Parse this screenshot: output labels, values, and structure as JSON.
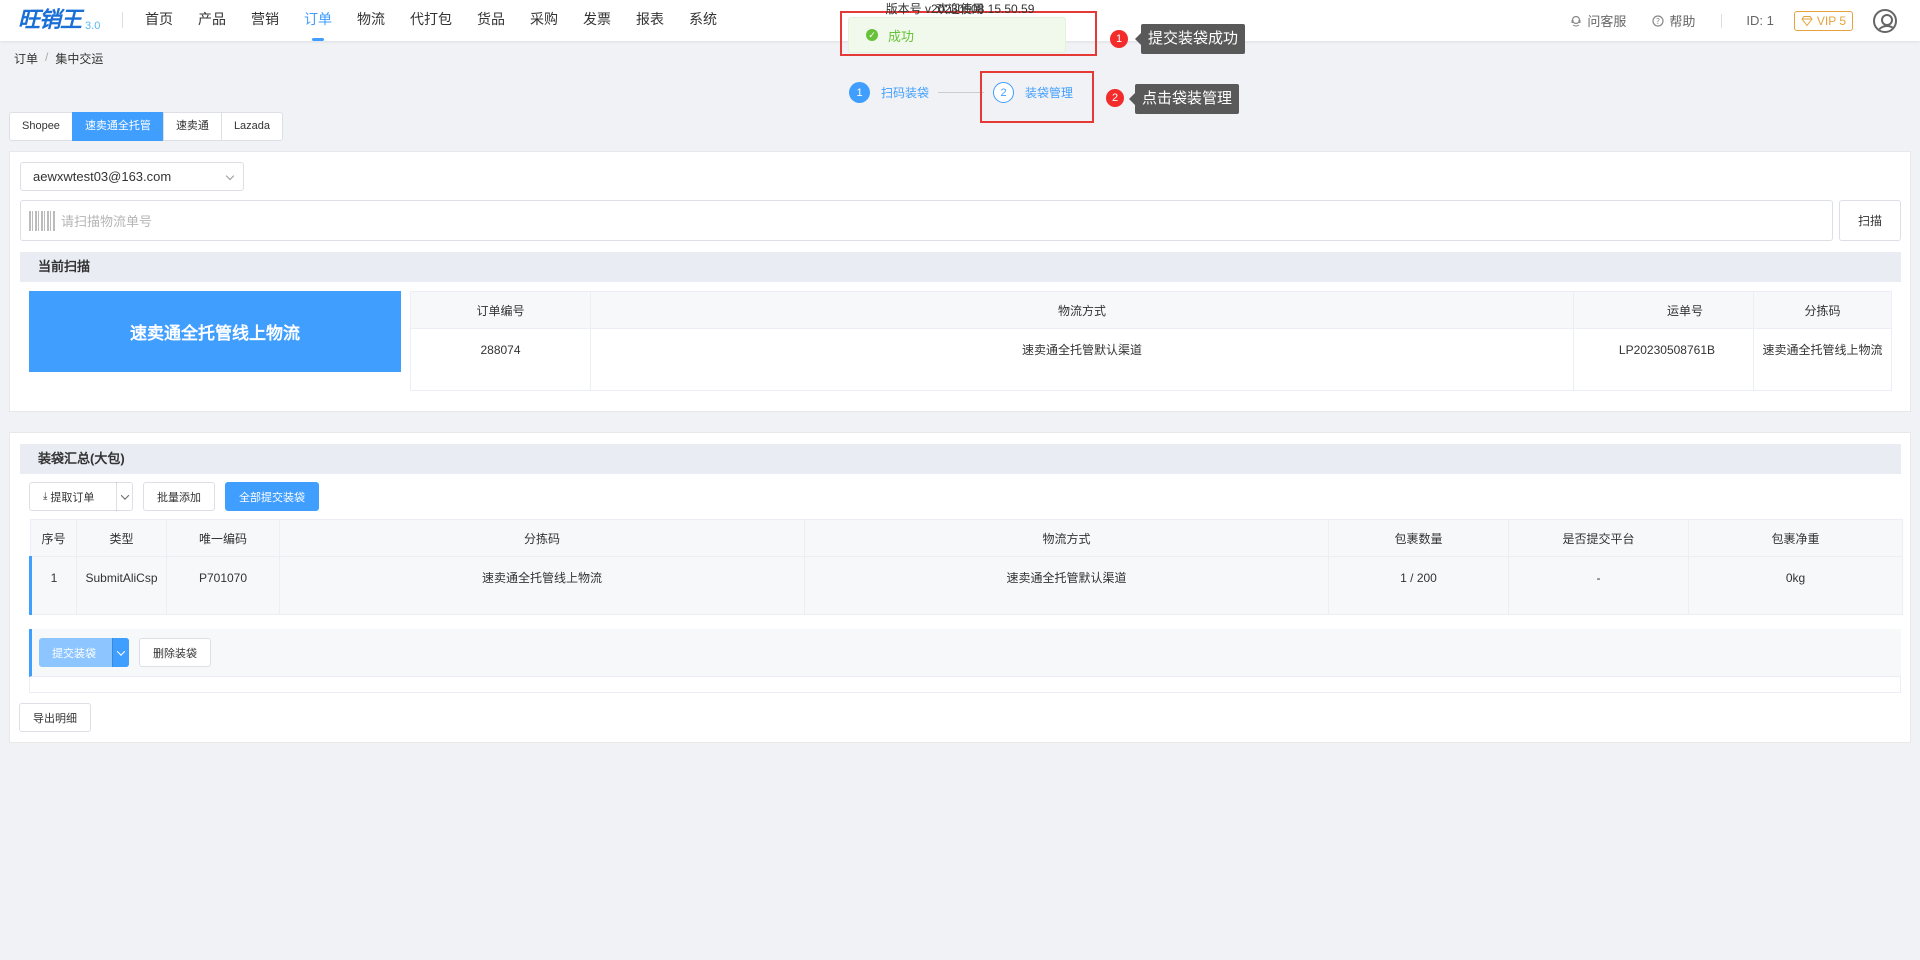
{
  "app": {
    "brand": "旺销王",
    "version_tag": "3.0"
  },
  "nav": [
    "首页",
    "产品",
    "营销",
    "订单",
    "物流",
    "代打包",
    "货品",
    "采购",
    "发票",
    "报表",
    "系统"
  ],
  "nav_active": "订单",
  "top_right": {
    "support": "问客服",
    "help": "帮助",
    "user_id": "ID: 1",
    "vip": "VIP 5"
  },
  "breadcrumb": {
    "root": "订单",
    "current": "集中交运"
  },
  "toast": {
    "message": "成功",
    "color": "#67c23a"
  },
  "annotations": [
    {
      "num": "1",
      "text": "提交装袋成功"
    },
    {
      "num": "2",
      "text": "点击袋装管理"
    }
  ],
  "steps": [
    {
      "num": "1",
      "label": "扫码装袋"
    },
    {
      "num": "2",
      "label": "装袋管理"
    }
  ],
  "platform_tabs": [
    "Shopee",
    "速卖通全托管",
    "速卖通",
    "Lazada"
  ],
  "platform_active": "速卖通全托管",
  "scan": {
    "account": "aewxwtest03@163.com",
    "placeholder": "请扫描物流单号",
    "scan_button": "扫描",
    "section_title": "当前扫描",
    "banner": "速卖通全托管线上物流",
    "columns": [
      "订单编号",
      "物流方式",
      "运单号",
      "分拣码"
    ],
    "row": [
      "288074",
      "速卖通全托管默认渠道",
      "LP20230508761B",
      "速卖通全托管线上物流"
    ]
  },
  "bags": {
    "section_title": "装袋汇总(大包)",
    "toolbar": {
      "fetch": "提取订单",
      "batch_add": "批量添加",
      "submit_all": "全部提交装袋"
    },
    "columns": [
      "序号",
      "类型",
      "唯一编码",
      "分拣码",
      "物流方式",
      "包裹数量",
      "是否提交平台",
      "包裹净重"
    ],
    "rows": [
      [
        "1",
        "SubmitAliCsp",
        "P701070",
        "速卖通全托管线上物流",
        "速卖通全托管默认渠道",
        "1 / 200",
        "-",
        "0kg"
      ]
    ],
    "row_actions": {
      "submit": "提交装袋",
      "delete": "删除装袋"
    }
  },
  "export_label": "导出明细",
  "footer": {
    "welcome": "欢迎使用",
    "version": "版本号 v20230508.15.50.59"
  },
  "colors": {
    "accent": "#409eff",
    "annotation": "#e53935",
    "vip": "#e6a23c"
  }
}
